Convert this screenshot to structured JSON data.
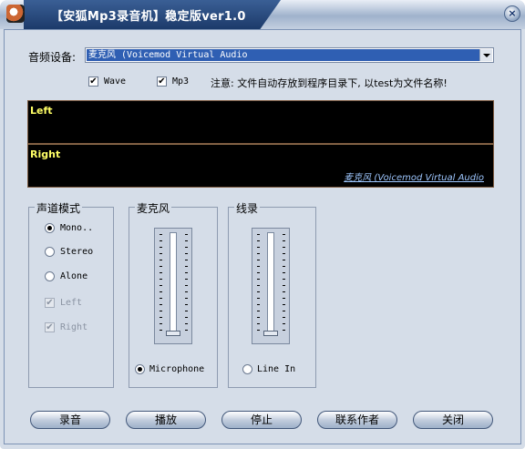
{
  "window": {
    "title": "【安狐Mp3录音机】稳定版ver1.0",
    "close_label": "×"
  },
  "device": {
    "label": "音频设备:",
    "selected": "麦克风 (Voicemod Virtual Audio"
  },
  "format": {
    "wave": {
      "label": "Wave",
      "checked": true
    },
    "mp3": {
      "label": "Mp3",
      "checked": true
    },
    "notice": "注意: 文件自动存放到程序目录下, 以test为文件名称!"
  },
  "meters": {
    "left_label": "Left",
    "right_label": "Right",
    "device_name": "麦克风 (Voicemod Virtual Audio"
  },
  "channel_mode": {
    "title": "声道模式",
    "options": [
      {
        "label": "Mono..",
        "selected": true
      },
      {
        "label": "Stereo",
        "selected": false
      },
      {
        "label": "Alone",
        "selected": false
      }
    ],
    "checks": [
      {
        "label": "Left",
        "checked": true,
        "disabled": true
      },
      {
        "label": "Right",
        "checked": true,
        "disabled": true
      }
    ]
  },
  "microphone": {
    "title": "麦克风",
    "radio_label": "Microphone",
    "selected": true,
    "level": 0.0
  },
  "line_in": {
    "title": "线录",
    "radio_label": "Line In",
    "selected": false,
    "level": 0.0
  },
  "buttons": {
    "record": "录音",
    "play": "播放",
    "stop": "停止",
    "contact": "联系作者",
    "close": "关闭"
  },
  "colors": {
    "title_bg": "#1c3a6a",
    "meter_bg": "#000000",
    "meter_label": "#ffff66",
    "selection": "#2f5fb3"
  }
}
